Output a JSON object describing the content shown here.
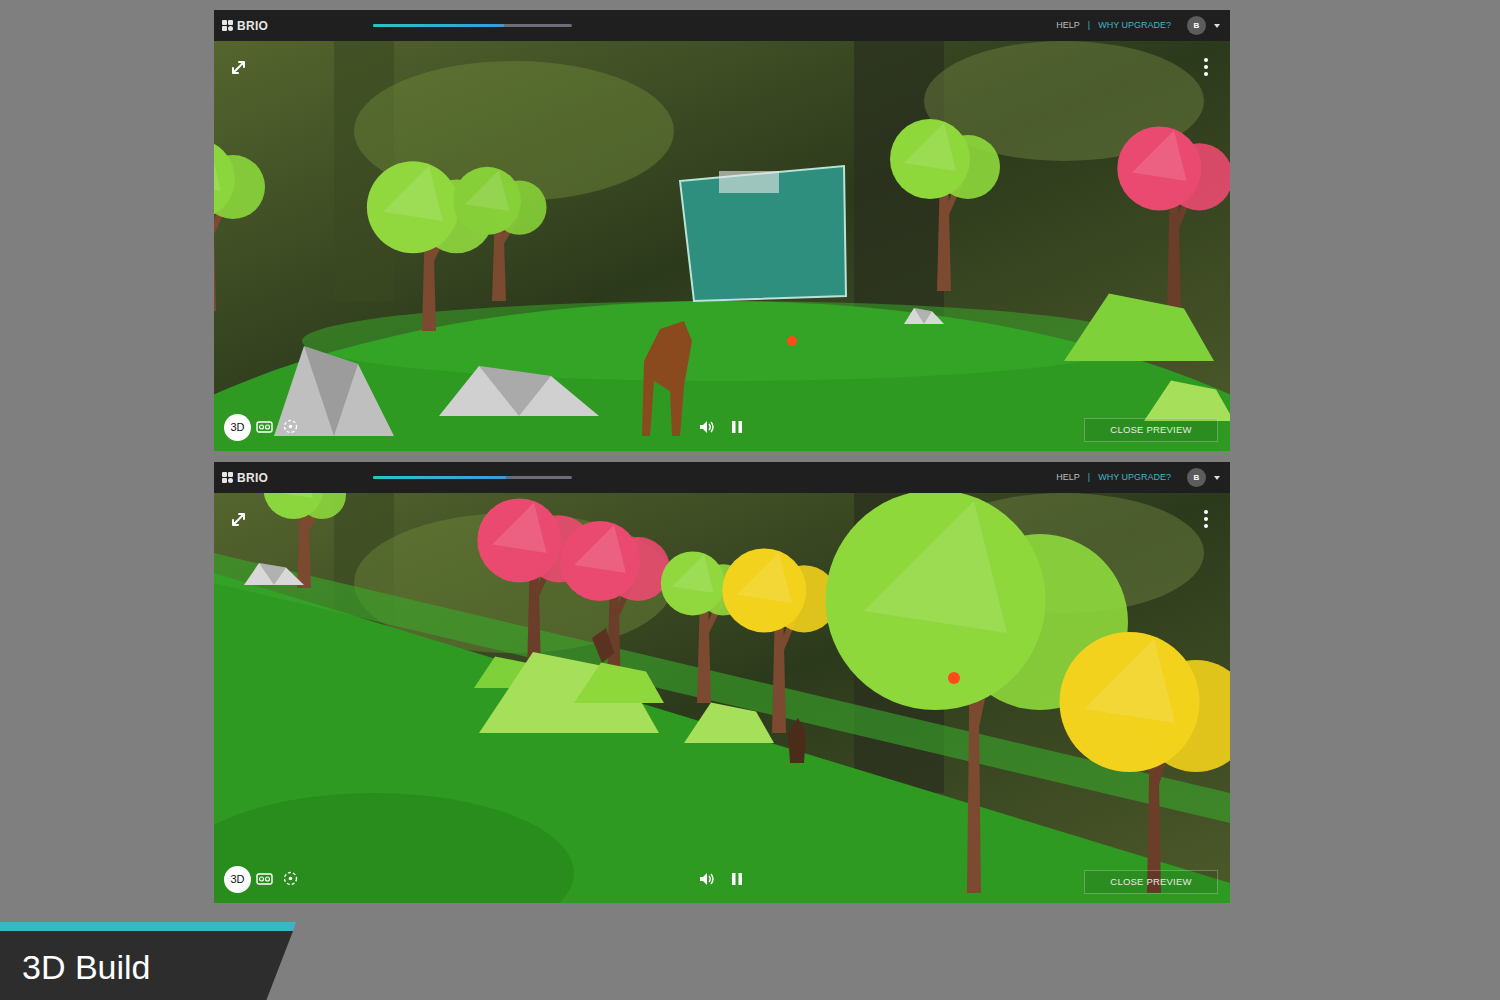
{
  "frames": [
    {
      "logo": "BRIO",
      "progress": {
        "level": 0.66
      },
      "links": [
        {
          "label": "HELP"
        },
        {
          "label": "WHY UPGRADE?"
        }
      ],
      "separator": "|",
      "avatar": "B",
      "mode_button": "3D",
      "close_button": "CLOSE PREVIEW",
      "muted": false,
      "playing": true
    },
    {
      "logo": "BRIO",
      "progress": {
        "level": 0.67
      },
      "links": [
        {
          "label": "HELP"
        },
        {
          "label": "WHY UPGRADE?"
        }
      ],
      "separator": "|",
      "avatar": "B",
      "mode_button": "3D",
      "close_button": "CLOSE PREVIEW",
      "muted": false,
      "playing": true
    }
  ],
  "caption": "3D Build"
}
